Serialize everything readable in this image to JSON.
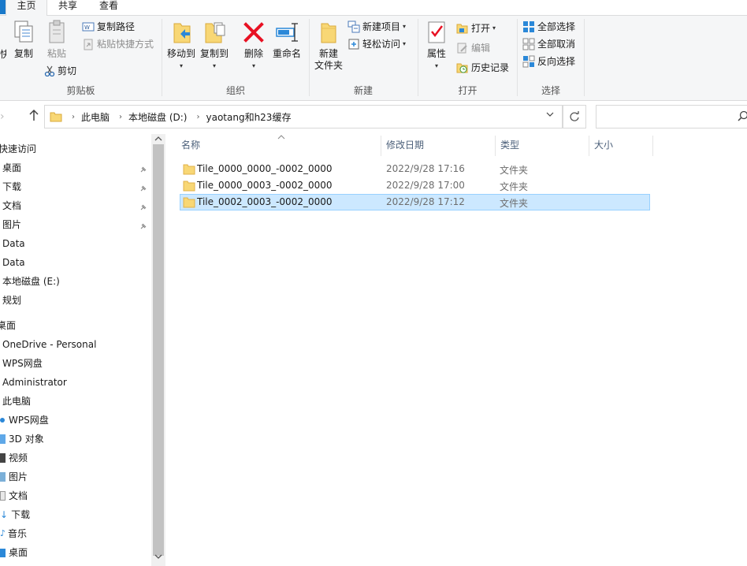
{
  "ribbon_tabs": {
    "home": "主页",
    "share": "共享",
    "view": "查看"
  },
  "clipboard": {
    "cut_partial": "快",
    "copy": "复制",
    "paste": "粘贴",
    "copy_path": "复制路径",
    "paste_shortcut": "粘贴快捷方式",
    "cut": "剪切",
    "label": "剪贴板"
  },
  "organize": {
    "move_to": "移动到",
    "copy_to": "复制到",
    "delete": "删除",
    "rename": "重命名",
    "label": "组织"
  },
  "new_group": {
    "new_folder": "新建\n文件夹",
    "new_item": "新建项目",
    "easy_access": "轻松访问",
    "label": "新建"
  },
  "open_group": {
    "properties": "属性",
    "open": "打开",
    "edit": "编辑",
    "history": "历史记录",
    "label": "打开"
  },
  "select_group": {
    "select_all": "全部选择",
    "select_none": "全部取消",
    "invert": "反向选择",
    "label": "选择"
  },
  "address": {
    "crumbs": [
      "此电脑",
      "本地磁盘 (D:)",
      "yaotang和h23缓存"
    ]
  },
  "nav": {
    "items": [
      {
        "label": "快速访问",
        "pinned": false
      },
      {
        "label": "桌面",
        "pinned": true
      },
      {
        "label": "下载",
        "pinned": true
      },
      {
        "label": "文档",
        "pinned": true
      },
      {
        "label": "图片",
        "pinned": true
      },
      {
        "label": "Data",
        "pinned": false
      },
      {
        "label": "Data",
        "pinned": false
      },
      {
        "label": "本地磁盘 (E:)",
        "pinned": false
      },
      {
        "label": "规划",
        "pinned": false
      },
      {
        "label": "桌面",
        "pinned": false
      },
      {
        "label": "OneDrive - Personal",
        "pinned": false
      },
      {
        "label": "WPS网盘",
        "pinned": false
      },
      {
        "label": "Administrator",
        "pinned": false
      },
      {
        "label": "此电脑",
        "pinned": false
      },
      {
        "label": "WPS网盘",
        "pinned": false
      },
      {
        "label": "3D 对象",
        "pinned": false
      },
      {
        "label": "视频",
        "pinned": false
      },
      {
        "label": "图片",
        "pinned": false
      },
      {
        "label": "文档",
        "pinned": false
      },
      {
        "label": "下载",
        "pinned": false
      },
      {
        "label": "音乐",
        "pinned": false
      },
      {
        "label": "桌面",
        "pinned": false
      }
    ]
  },
  "columns": {
    "name": "名称",
    "modified": "修改日期",
    "type": "类型",
    "size": "大小"
  },
  "files": [
    {
      "name": "Tile_0000_0000_-0002_0000",
      "date": "2022/9/28 17:16",
      "type": "文件夹",
      "selected": false
    },
    {
      "name": "Tile_0000_0003_-0002_0000",
      "date": "2022/9/28 17:00",
      "type": "文件夹",
      "selected": false
    },
    {
      "name": "Tile_0002_0003_-0002_0000",
      "date": "2022/9/28 17:12",
      "type": "文件夹",
      "selected": true
    }
  ],
  "colors": {
    "accent": "#1979ca",
    "selection_bg": "#cce8ff",
    "selection_border": "#99d1ff",
    "folder": "#f8d775",
    "delete_red": "#e81123"
  }
}
